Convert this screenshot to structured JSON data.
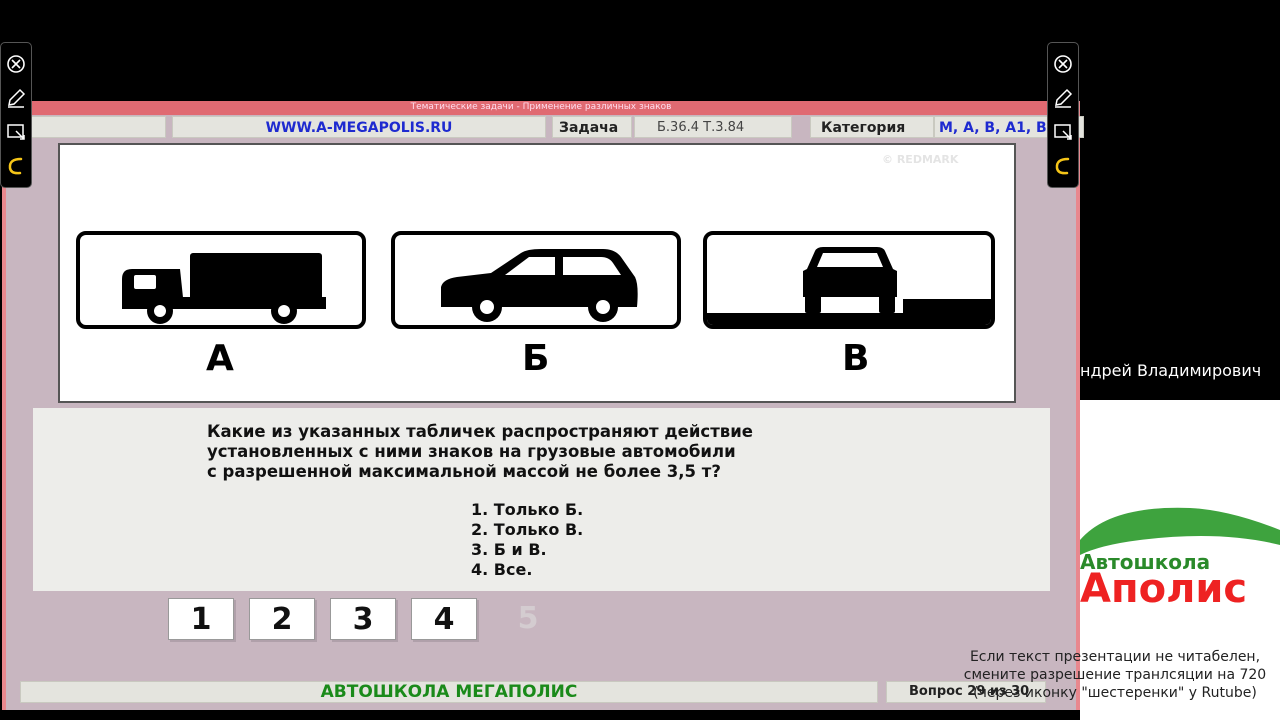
{
  "window": {
    "title": "Тематические задачи - Применение различных знаков"
  },
  "infobar": {
    "site": "WWW.A-MEGAPOLIS.RU",
    "task_label": "Задача",
    "task_value": "Б.36.4   Т.3.84",
    "category_label": "Категория",
    "category_value": "M, A, B, A1, B"
  },
  "image": {
    "watermark": "© REDMARK",
    "signs": [
      {
        "letter": "А",
        "icon": "truck-icon"
      },
      {
        "letter": "Б",
        "icon": "car-side-icon"
      },
      {
        "letter": "В",
        "icon": "car-front-icon"
      }
    ]
  },
  "question": {
    "lines": [
      "Какие из указанных табличек распространяют действие",
      "установленных с ними знаков на грузовые автомобили",
      "с разрешенной максимальной массой не более 3,5 т?"
    ],
    "answers": [
      "1. Только Б.",
      "2. Только В.",
      "3. Б и В.",
      "4. Все."
    ]
  },
  "answer_buttons": [
    "1",
    "2",
    "3",
    "4"
  ],
  "answer_button_disabled": "5",
  "footer": {
    "school": "АВТОШКОЛА МЕГАПОЛИС",
    "question_counter": "Вопрос 29 из 30"
  },
  "stream": {
    "presenter_name": "ндрей Владимирович",
    "logo_top": "Автошкола",
    "logo_bottom": "Аполис",
    "notice_lines": [
      "Если текст презентации не читабелен,",
      "смените разрешение транлсяции на 720",
      "(через иконку \"шестеренки\" у Rutube)"
    ]
  },
  "toolbar_icons": [
    "close-circle-icon",
    "pen-icon",
    "screen-select-icon",
    "undo-icon"
  ],
  "colors": {
    "window_bg": "#c8b6c0",
    "title_red": "#e06a72",
    "link_blue": "#1e2ad0",
    "school_green": "#1a8a1a",
    "logo_red": "#e22222"
  }
}
